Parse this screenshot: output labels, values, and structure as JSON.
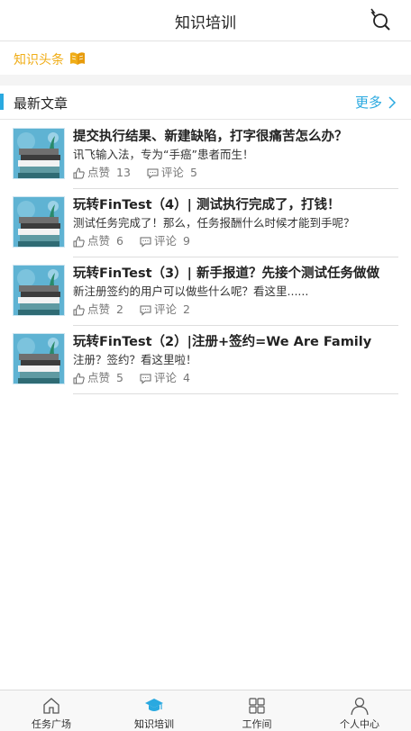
{
  "header": {
    "title": "知识培训"
  },
  "headline": {
    "label": "知识头条"
  },
  "section": {
    "title": "最新文章",
    "more_label": "更多"
  },
  "articles": [
    {
      "title": "提交执行结果、新建缺陷，打字很痛苦怎么办？",
      "summary": "讯飞输入法，专为“手癌”患者而生！",
      "like_label": "点赞",
      "likes": "13",
      "comment_label": "评论",
      "comments": "5"
    },
    {
      "title": "玩转FinTest（4）| 测试执行完成了，打钱！",
      "summary": "测试任务完成了！那么，任务报酬什么时候才能到手呢？",
      "like_label": "点赞",
      "likes": "6",
      "comment_label": "评论",
      "comments": "9"
    },
    {
      "title": "玩转FinTest（3）| 新手报道？先接个测试任务做做",
      "summary": "新注册签约的用户可以做些什么呢？看这里......",
      "like_label": "点赞",
      "likes": "2",
      "comment_label": "评论",
      "comments": "2"
    },
    {
      "title": "玩转FinTest（2）|注册+签约=We Are Family",
      "summary": "注册？签约？看这里啦！",
      "like_label": "点赞",
      "likes": "5",
      "comment_label": "评论",
      "comments": "4"
    }
  ],
  "tabs": [
    {
      "label": "任务广场",
      "icon": "home-icon"
    },
    {
      "label": "知识培训",
      "icon": "graduation-cap-icon",
      "active": true
    },
    {
      "label": "工作间",
      "icon": "grid-icon"
    },
    {
      "label": "个人中心",
      "icon": "person-icon"
    }
  ],
  "colors": {
    "accent": "#2aa9e0",
    "headline": "#f0ad17"
  }
}
